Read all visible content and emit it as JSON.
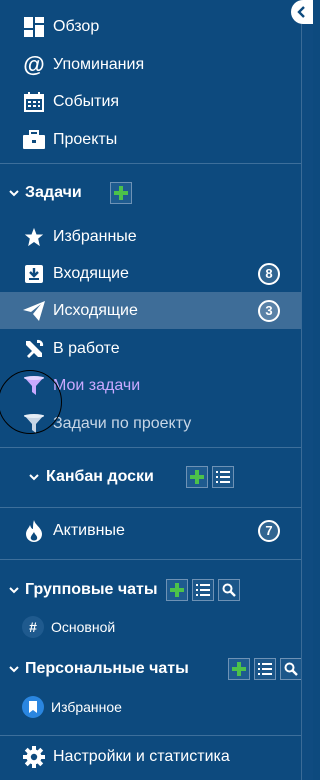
{
  "nav": {
    "overview": "Обзор",
    "mentions": "Упоминания",
    "events": "События",
    "projects": "Проекты"
  },
  "tasks": {
    "title": "Задачи",
    "favorites": "Избранные",
    "inbox": "Входящие",
    "inbox_count": "8",
    "outgoing": "Исходящие",
    "outgoing_count": "3",
    "in_progress": "В работе",
    "my_tasks": "Мои задачи",
    "by_project": "Задачи по проекту"
  },
  "kanban": {
    "title": "Канбан доски"
  },
  "active": {
    "label": "Активные",
    "count": "7"
  },
  "group_chats": {
    "title": "Групповые чаты",
    "main_hash": "#",
    "main": "Основной"
  },
  "personal_chats": {
    "title": "Персональные чаты",
    "favorite": "Избранное"
  },
  "settings": {
    "label": "Настройки и статистика"
  },
  "colors": {
    "sidebar_bg": "#0d4a7e",
    "active_bg": "#3e6d98",
    "accent_green": "#4cc24a",
    "purple": "#c9a9ff"
  }
}
